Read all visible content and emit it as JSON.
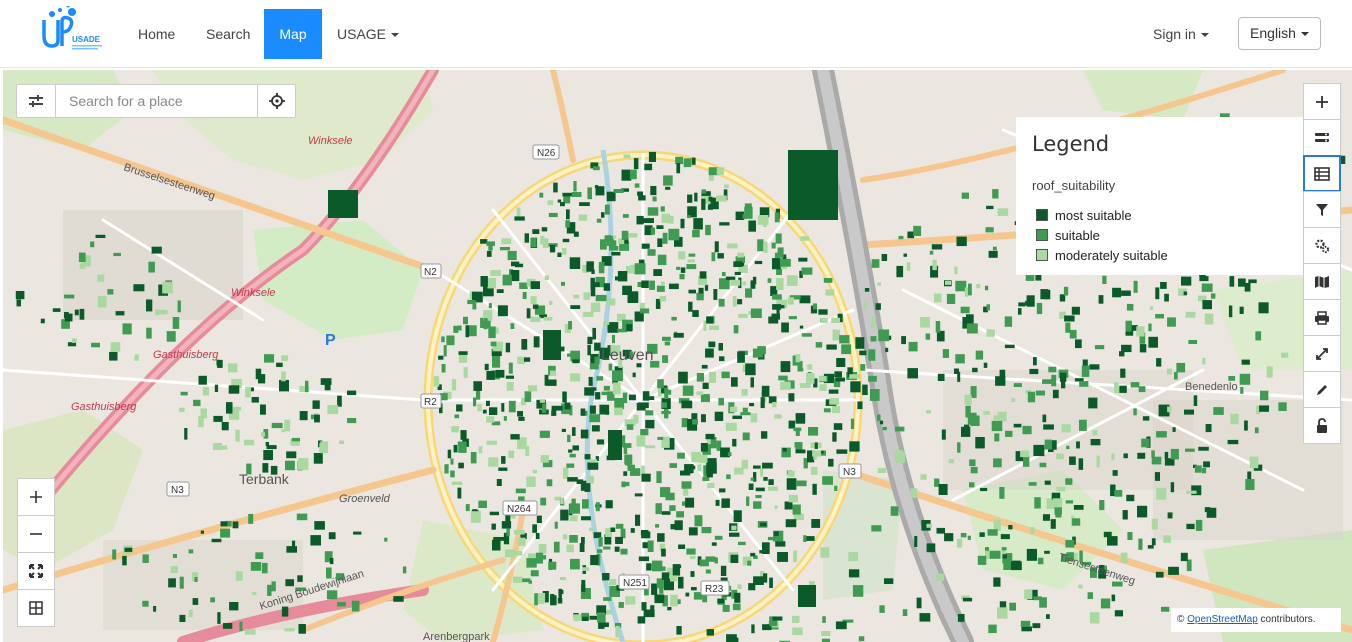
{
  "navbar": {
    "logo_text": "USADE",
    "items": [
      {
        "label": "Home"
      },
      {
        "label": "Search"
      },
      {
        "label": "Map"
      },
      {
        "label": "USAGE"
      }
    ],
    "sign_in": "Sign in",
    "language": "English"
  },
  "search": {
    "placeholder": "Search for a place"
  },
  "legend": {
    "title": "Legend",
    "layer": "roof_suitability",
    "items": [
      {
        "label": "most suitable",
        "color": "#0b5a2a"
      },
      {
        "label": "suitable",
        "color": "#3f9a52"
      },
      {
        "label": "moderately suitable",
        "color": "#a9d9a0"
      }
    ]
  },
  "map_labels": {
    "city": "Leuven",
    "terbank": "Terbank",
    "winksele1": "Winksele",
    "winksele2": "Winksele",
    "gasthuisberg1": "Gasthuisberg",
    "gasthuisberg2": "Gasthuisberg",
    "brusselsesteenweg": "Brusselsesteenweg",
    "benedenlo": "Benedenlo",
    "groenveld": "Groenveld",
    "koning": "Koning Boudewijnlaan",
    "arenberg": "Arenbergpark",
    "tiensesteenweg": "Tiensesteenweg",
    "n26": "N26",
    "n2": "N2",
    "r2": "R2",
    "n3a": "N3",
    "n3b": "N3",
    "n264": "N264",
    "n251": "N251",
    "r23": "R23",
    "p_label": "P"
  },
  "attribution": {
    "prefix": "©",
    "link": "OpenStreetMap",
    "suffix": "contributors."
  },
  "colors": {
    "accent": "#1a8cff",
    "most_suitable": "#0b5a2a",
    "suitable": "#3f9a52",
    "moderately_suitable": "#a9d9a0"
  }
}
